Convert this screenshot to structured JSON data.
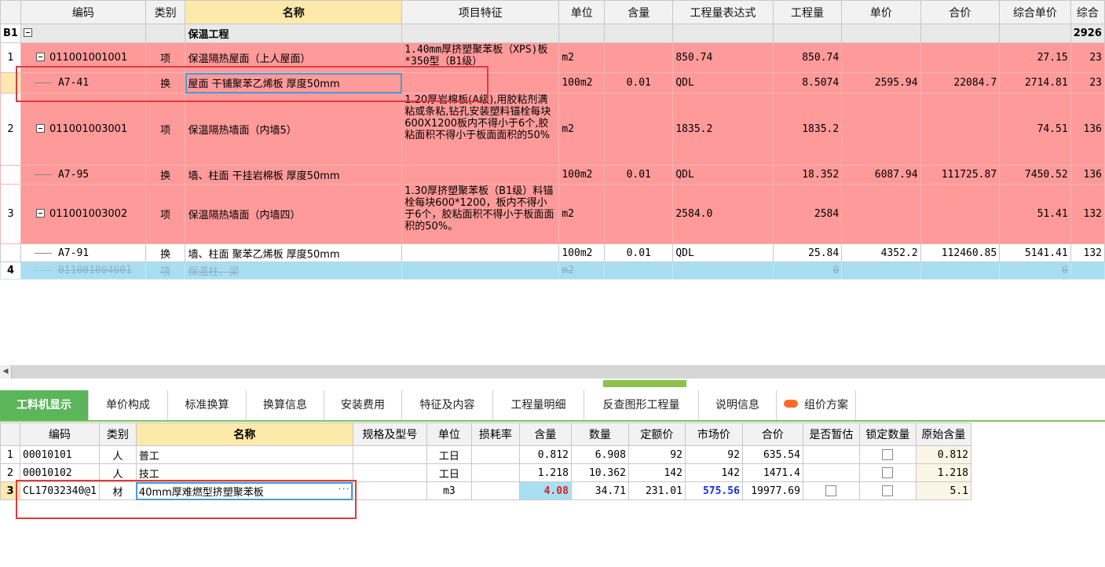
{
  "top_table": {
    "headers": [
      "",
      "编码",
      "类别",
      "名称",
      "项目特征",
      "单位",
      "含量",
      "工程量表达式",
      "工程量",
      "单价",
      "合价",
      "综合单价",
      "综合"
    ],
    "b1": {
      "row": "B1",
      "name": "保温工程",
      "comp": "2926"
    },
    "rows": [
      {
        "row": "1",
        "code": "011001001001",
        "type": "项",
        "name": "保温隔热屋面（上人屋面）",
        "feature": "1.40mm厚挤塑聚苯板（XPS)板*350型（B1级）",
        "unit": "m2",
        "content": "",
        "expr": "850.74",
        "qty": "850.74",
        "price": "",
        "total": "",
        "unit_comp": "27.15",
        "comp": "23"
      },
      {
        "row": "",
        "code": "A7-41",
        "type": "换",
        "name": "屋面 干铺聚苯乙烯板 厚度50mm",
        "feature": "",
        "unit": "100m2",
        "content": "0.01",
        "expr": "QDL",
        "qty": "8.5074",
        "price": "2595.94",
        "total": "22084.7",
        "unit_comp": "2714.81",
        "comp": "23"
      },
      {
        "row": "2",
        "code": "011001003001",
        "type": "项",
        "name": "保温隔热墙面（内墙5）",
        "feature": "1.20厚岩棉板(A级),用胶粘剂满粘或条粘,钻孔安装塑料锚栓每块600X1200板内不得小于6个,胶粘面积不得小于板面面积的50%",
        "unit": "m2",
        "content": "",
        "expr": "1835.2",
        "qty": "1835.2",
        "price": "",
        "total": "",
        "unit_comp": "74.51",
        "comp": "136"
      },
      {
        "row": "",
        "code": "A7-95",
        "type": "换",
        "name": "墙、柱面 干挂岩棉板 厚度50mm",
        "feature": "",
        "unit": "100m2",
        "content": "0.01",
        "expr": "QDL",
        "qty": "18.352",
        "price": "6087.94",
        "total": "111725.87",
        "unit_comp": "7450.52",
        "comp": "136"
      },
      {
        "row": "3",
        "code": "011001003002",
        "type": "项",
        "name": "保温隔热墙面（内墙四）",
        "feature": "1.30厚挤塑聚苯板（B1级）料锚栓每块600*1200，板内不得小于6个，胶粘面积不得小于板面面积的50%。",
        "unit": "m2",
        "content": "",
        "expr": "2584.0",
        "qty": "2584",
        "price": "",
        "total": "",
        "unit_comp": "51.41",
        "comp": "132"
      },
      {
        "row": "",
        "code": "A7-91",
        "type": "换",
        "name": "墙、柱面 聚苯乙烯板 厚度50mm",
        "feature": "",
        "unit": "100m2",
        "content": "0.01",
        "expr": "QDL",
        "qty": "25.84",
        "price": "4352.2",
        "total": "112460.85",
        "unit_comp": "5141.41",
        "comp": "132"
      },
      {
        "row": "4",
        "code": "011001004001",
        "type": "项",
        "name": "保温柱、梁",
        "feature": "",
        "unit": "m2",
        "content": "",
        "expr": "",
        "qty": "0",
        "price": "",
        "total": "",
        "unit_comp": "0",
        "comp": ""
      }
    ]
  },
  "tabs": [
    "工料机显示",
    "单价构成",
    "标准换算",
    "换算信息",
    "安装费用",
    "特征及内容",
    "工程量明细",
    "反查图形工程量",
    "说明信息",
    "组价方案"
  ],
  "bottom_table": {
    "headers": [
      "",
      "编码",
      "类别",
      "名称",
      "规格及型号",
      "单位",
      "损耗率",
      "含量",
      "数量",
      "定额价",
      "市场价",
      "合价",
      "是否暂估",
      "锁定数量",
      "原始含量"
    ],
    "rows": [
      {
        "row": "1",
        "code": "00010101",
        "type": "人",
        "name": "普工",
        "spec": "",
        "unit": "工日",
        "loss": "",
        "content": "0.812",
        "qty": "6.908",
        "base_price": "92",
        "market": "92",
        "total": "635.54",
        "orig": "0.812"
      },
      {
        "row": "2",
        "code": "00010102",
        "type": "人",
        "name": "技工",
        "spec": "",
        "unit": "工日",
        "loss": "",
        "content": "1.218",
        "qty": "10.362",
        "base_price": "142",
        "market": "142",
        "total": "1471.4",
        "orig": "1.218"
      },
      {
        "row": "3",
        "code": "CL17032340@1",
        "type": "材",
        "name": "40mm厚难燃型挤塑聚苯板",
        "spec": "",
        "unit": "m3",
        "loss": "",
        "content": "4.08",
        "qty": "34.71",
        "base_price": "231.01",
        "market": "575.56",
        "total": "19977.69",
        "orig": "5.1"
      }
    ]
  },
  "edit_more": "···"
}
